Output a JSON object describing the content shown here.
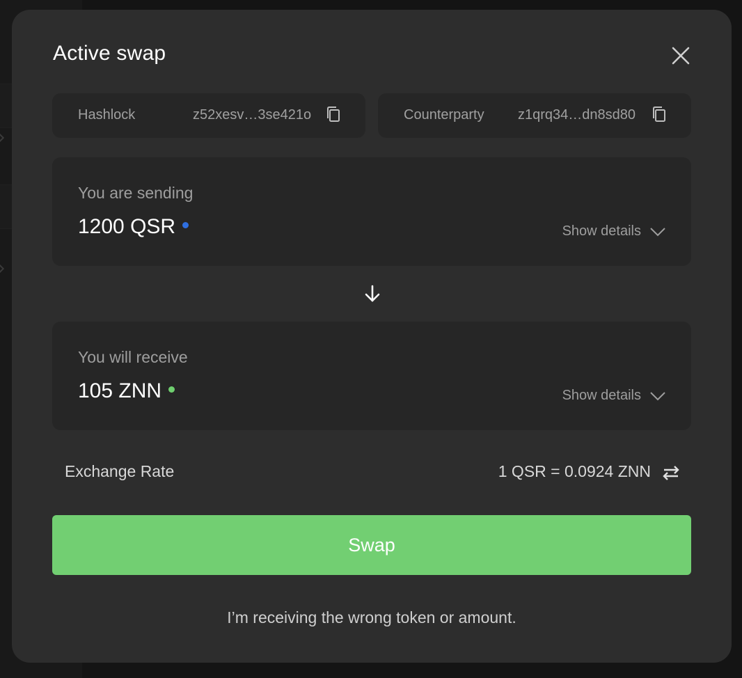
{
  "dialog": {
    "title": "Active swap"
  },
  "hashlock": {
    "label": "Hashlock",
    "value": "z52xesv…3se421o"
  },
  "counterparty": {
    "label": "Counterparty",
    "value": "z1qrq34…dn8sd80"
  },
  "sending": {
    "label": "You are sending",
    "amount": "1200 QSR",
    "dot_color": "#2f6fe0",
    "details_label": "Show details"
  },
  "receiving": {
    "label": "You will receive",
    "amount": "105 ZNN",
    "dot_color": "#6fcf6f",
    "details_label": "Show details"
  },
  "exchange_rate": {
    "label": "Exchange Rate",
    "value": "1 QSR = 0.0924 ZNN"
  },
  "swap_button": {
    "label": "Swap",
    "color": "#72cf72"
  },
  "wrong_token_link": {
    "label": "I’m receiving the wrong token or amount."
  }
}
